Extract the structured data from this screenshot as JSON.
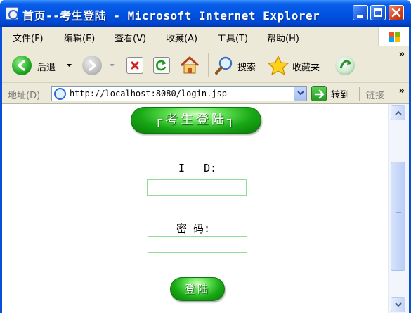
{
  "window": {
    "title": "首页--考生登陆 - Microsoft Internet Explorer"
  },
  "menu": [
    {
      "label": "文件(F)"
    },
    {
      "label": "编辑(E)"
    },
    {
      "label": "查看(V)"
    },
    {
      "label": "收藏(A)"
    },
    {
      "label": "工具(T)"
    },
    {
      "label": "帮助(H)"
    }
  ],
  "toolbar": {
    "back_label": "后退",
    "search_label": "搜索",
    "favorites_label": "收藏夹",
    "overflow": "»"
  },
  "address": {
    "label": "地址(D)",
    "url": "http://localhost:8080/login.jsp",
    "go_label": "转到",
    "links_label": "链接",
    "overflow": "»"
  },
  "page": {
    "header": "考生登陆",
    "id_label": "I   D:",
    "id_value": "",
    "password_label": "密 码:",
    "password_value": "",
    "login_button": "登陆"
  },
  "colors": {
    "title_bar": "#0054e3",
    "chrome": "#ece9d8",
    "button_green": "#19a816",
    "input_border": "#8ee08e"
  },
  "icons": {
    "title": "ie-page-icon",
    "back": "back-arrow-icon",
    "forward": "forward-arrow-icon",
    "stop": "stop-icon",
    "refresh": "refresh-icon",
    "home": "home-icon",
    "search": "search-icon",
    "favorites": "favorites-star-icon",
    "media": "media-icon",
    "go": "go-arrow-icon"
  }
}
